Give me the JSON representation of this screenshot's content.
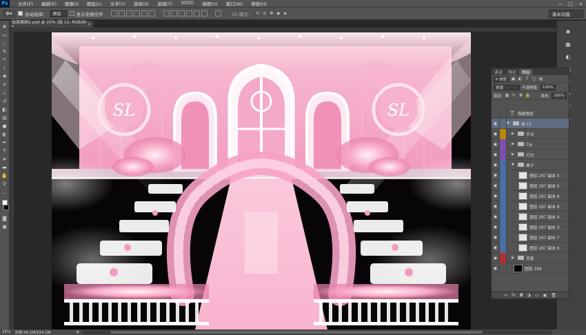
{
  "app": {
    "logo": "Ps"
  },
  "menu": [
    "文件(F)",
    "编辑(E)",
    "图像(I)",
    "图层(L)",
    "文字(Y)",
    "选择(S)",
    "滤镜(T)",
    "3D(D)",
    "视图(V)",
    "窗口(W)",
    "帮助(H)"
  ],
  "window_controls": {
    "minimize": "—",
    "maximize": "□",
    "close": "×"
  },
  "options": {
    "auto_select_label": "自动选择：",
    "auto_select_value": "图层",
    "show_transform_label": "显示变换控件",
    "mode_3d_label": "3D 模式：",
    "workspace": "基本功能"
  },
  "document": {
    "tab_title": "仙效果图2.psd @ 25% (组 12, RGB/8) *",
    "close": "×",
    "zoom": "25%",
    "doc_size": "文档:56.2M/224.1M"
  },
  "canvas_art": {
    "logo_text": "SL"
  },
  "layers_panel": {
    "tabs": [
      "通道",
      "路径",
      "图层"
    ],
    "active_tab": 2,
    "filter_label": "P 类型",
    "blend_mode": "穿透",
    "opacity_label": "不透明度:",
    "opacity_value": "100%",
    "lock_label": "锁定:",
    "fill_label": "填充:",
    "fill_value": "100%",
    "layers": [
      {
        "name": "隐藏图层",
        "kind": "text",
        "visible": false,
        "tag": "",
        "depth": 0
      },
      {
        "name": "组 12",
        "kind": "group-open",
        "visible": true,
        "tag": "",
        "depth": 0,
        "selected": true
      },
      {
        "name": "手冰",
        "kind": "group",
        "visible": true,
        "tag": "#b8860b",
        "depth": 1
      },
      {
        "name": "T台",
        "kind": "group",
        "visible": true,
        "tag": "#7b4fb0",
        "depth": 1
      },
      {
        "name": "灯光",
        "kind": "group",
        "visible": true,
        "tag": "#7b4fb0",
        "depth": 1
      },
      {
        "name": "桌子",
        "kind": "group-open",
        "visible": true,
        "tag": "#4a6ea8",
        "depth": 1
      },
      {
        "name": "图层 287 副本 5",
        "kind": "pixel",
        "visible": true,
        "tag": "#4a6ea8",
        "depth": 2
      },
      {
        "name": "图层 287 副本 5",
        "kind": "pixel",
        "visible": true,
        "tag": "#4a6ea8",
        "depth": 2
      },
      {
        "name": "图层 287 副本 8",
        "kind": "pixel",
        "visible": true,
        "tag": "#4a6ea8",
        "depth": 2
      },
      {
        "name": "图层 287 副本 8",
        "kind": "pixel",
        "visible": true,
        "tag": "#4a6ea8",
        "depth": 2
      },
      {
        "name": "图层 287 副本 4",
        "kind": "pixel",
        "visible": true,
        "tag": "#4a6ea8",
        "depth": 2
      },
      {
        "name": "图层 287 副本 3",
        "kind": "pixel",
        "visible": true,
        "tag": "#4a6ea8",
        "depth": 2
      },
      {
        "name": "图层 287 副本 7",
        "kind": "pixel",
        "visible": true,
        "tag": "#4a6ea8",
        "depth": 2
      },
      {
        "name": "图层 287 副本 6",
        "kind": "pixel",
        "visible": true,
        "tag": "#4a6ea8",
        "depth": 2
      },
      {
        "name": "背景",
        "kind": "group",
        "visible": true,
        "tag": "#b03030",
        "depth": 1
      },
      {
        "name": "图层 189",
        "kind": "black",
        "visible": true,
        "tag": "",
        "depth": 1
      }
    ],
    "bottom_icons": [
      "∞",
      "fx",
      "◘",
      "◑",
      "▭",
      "▣",
      "🗑"
    ]
  },
  "colors": {
    "pink_main": "#f4a9c8",
    "pink_light": "#fbd7e6",
    "pink_deep": "#e66c9e"
  }
}
